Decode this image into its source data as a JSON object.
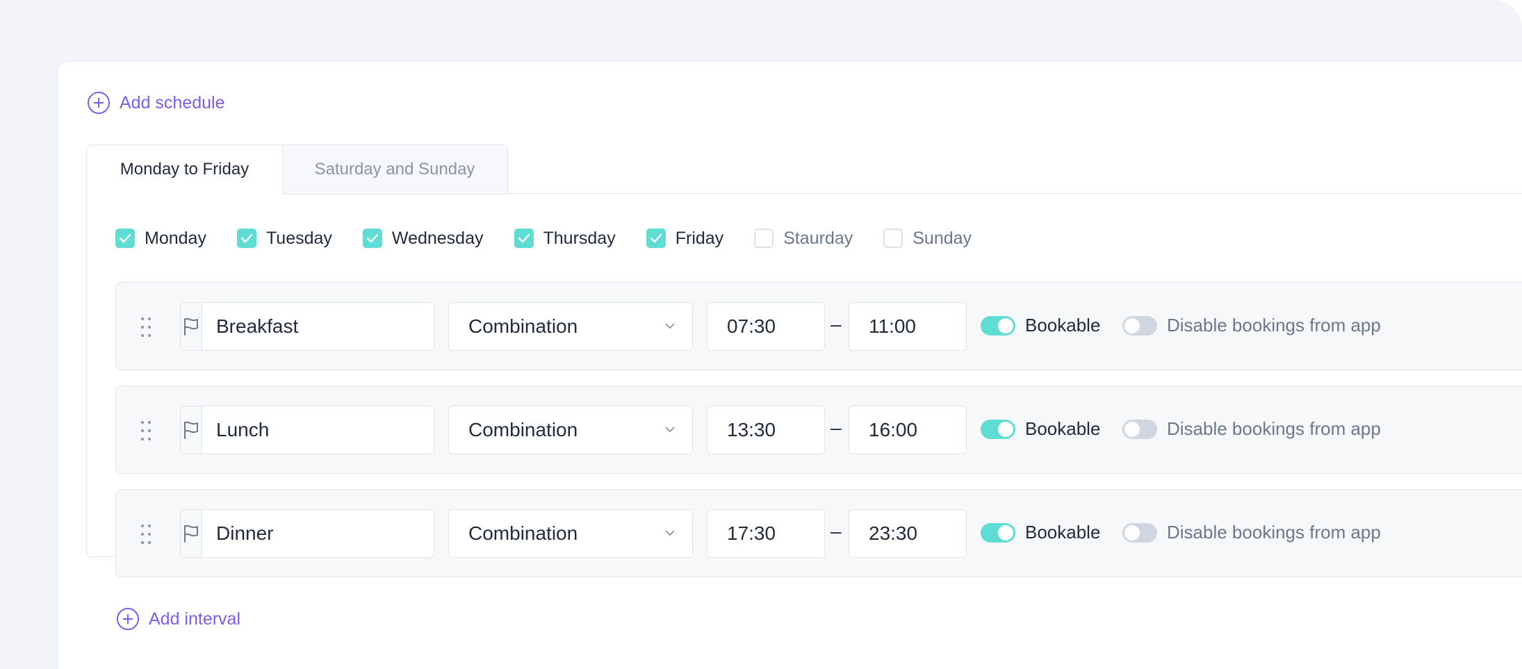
{
  "add_schedule_label": "Add schedule",
  "tabs": [
    {
      "label": "Monday to Friday",
      "active": true
    },
    {
      "label": "Saturday and Sunday",
      "active": false
    }
  ],
  "days": [
    {
      "label": "Monday",
      "checked": true
    },
    {
      "label": "Tuesday",
      "checked": true
    },
    {
      "label": "Wednesday",
      "checked": true
    },
    {
      "label": "Thursday",
      "checked": true
    },
    {
      "label": "Friday",
      "checked": true
    },
    {
      "label": "Staurday",
      "checked": false
    },
    {
      "label": "Sunday",
      "checked": false
    }
  ],
  "intervals": [
    {
      "name": "Breakfast",
      "type": "Combination",
      "start": "07:30",
      "separator": "–",
      "end": "11:00",
      "bookable_label": "Bookable",
      "bookable": true,
      "disable_label": "Disable bookings from app",
      "disable": false
    },
    {
      "name": "Lunch",
      "type": "Combination",
      "start": "13:30",
      "separator": "–",
      "end": "16:00",
      "bookable_label": "Bookable",
      "bookable": true,
      "disable_label": "Disable bookings from app",
      "disable": false
    },
    {
      "name": "Dinner",
      "type": "Combination",
      "start": "17:30",
      "separator": "–",
      "end": "23:30",
      "bookable_label": "Bookable",
      "bookable": true,
      "disable_label": "Disable bookings from app",
      "disable": false
    }
  ],
  "add_interval_label": "Add interval",
  "colors": {
    "accent": "#7b5cf0",
    "toggle_on": "#5fdcd3",
    "toggle_off": "#cfd6e0",
    "text": "#1f2b3d",
    "muted": "#6b778a"
  },
  "icons": {
    "add": "plus-circle-icon",
    "drag": "drag-handle-icon",
    "flag": "flag-icon",
    "dropdown": "chevron-down-icon",
    "check": "checkmark-icon"
  }
}
